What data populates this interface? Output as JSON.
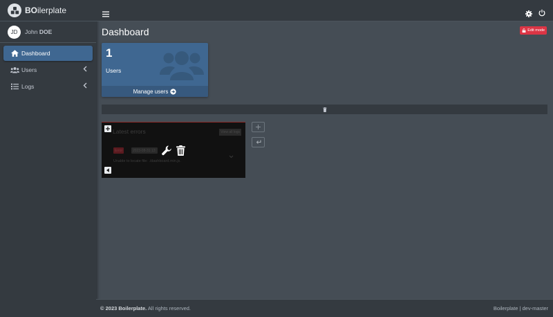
{
  "brand": {
    "bold": "BO",
    "rest": "ilerplate",
    "logo_icon": "cubes-icon"
  },
  "user": {
    "initials": "JD",
    "first": "John",
    "last": "DOE"
  },
  "sidebar": {
    "items": [
      {
        "label": "Dashboard",
        "icon": "home-icon",
        "active": true
      },
      {
        "label": "Users",
        "icon": "users-icon"
      },
      {
        "label": "Logs",
        "icon": "list-icon"
      }
    ]
  },
  "header": {
    "title": "Dashboard",
    "edit_label": "Edit mode"
  },
  "small_box": {
    "value": "1",
    "label": "Users",
    "footer": "Manage users"
  },
  "card": {
    "title": "Latest errors",
    "view_all": "View all logs",
    "badge": "Error",
    "date": "2023-08-31 13:",
    "message": "Unable to locate file: ./dashboard.min.js."
  },
  "footer": {
    "left_bold": "© 2023 Boilerplate.",
    "left_rest": " All rights reserved.",
    "right": "Boilerplate | dev-master"
  },
  "colors": {
    "sidebar": "#343a40",
    "content": "#454d55",
    "primary": "#3f6791",
    "danger": "#dc3545"
  }
}
